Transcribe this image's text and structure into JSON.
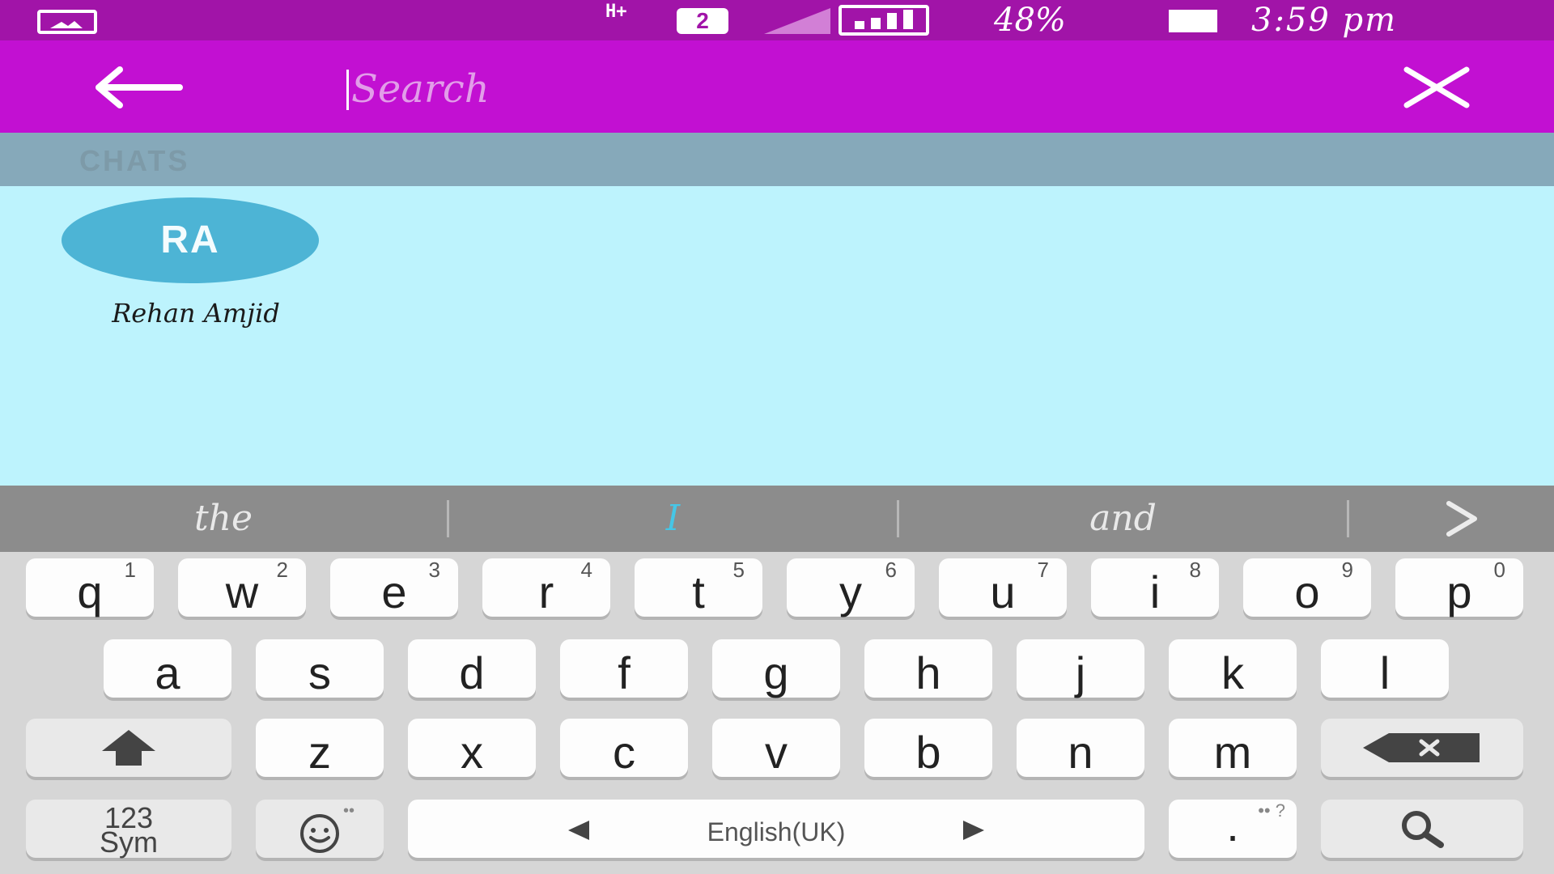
{
  "status_bar": {
    "network_label": "H+",
    "sim_label": "2",
    "battery_percent": "48%",
    "time": "3:59 pm",
    "icons": [
      "gallery-icon",
      "network-type-icon",
      "sim-icon",
      "signal-icon",
      "signal-icon",
      "battery-icon"
    ]
  },
  "toolbar": {
    "search_placeholder": "Search",
    "back_icon": "arrow-left-icon",
    "close_icon": "close-icon"
  },
  "chats": {
    "section_label": "CHATS",
    "contacts": [
      {
        "initials": "RA",
        "name": "Rehan Amjid",
        "avatar_color": "#4db4d5"
      }
    ]
  },
  "suggestions": {
    "items": [
      "the",
      "I",
      "and"
    ],
    "highlight_color": "#46c6e6",
    "more_icon": "chevron-right-icon"
  },
  "keyboard": {
    "row1": [
      {
        "key": "q",
        "num": "1"
      },
      {
        "key": "w",
        "num": "2"
      },
      {
        "key": "e",
        "num": "3"
      },
      {
        "key": "r",
        "num": "4"
      },
      {
        "key": "t",
        "num": "5"
      },
      {
        "key": "y",
        "num": "6"
      },
      {
        "key": "u",
        "num": "7"
      },
      {
        "key": "i",
        "num": "8"
      },
      {
        "key": "o",
        "num": "9"
      },
      {
        "key": "p",
        "num": "0"
      }
    ],
    "row2": [
      "a",
      "s",
      "d",
      "f",
      "g",
      "h",
      "j",
      "k",
      "l"
    ],
    "row3": [
      "z",
      "x",
      "c",
      "v",
      "b",
      "n",
      "m"
    ],
    "sym_line1": "123",
    "sym_line2": "Sym",
    "space_label": "English(UK)",
    "period_label": ".",
    "period_hint": "•• ?",
    "emoji_hint": "••",
    "shift_icon": "shift-icon",
    "backspace_icon": "backspace-icon",
    "emoji_icon": "emoji-icon",
    "search_icon": "search-icon",
    "colors": {
      "toolbar": "#c210d2",
      "status_bar": "#a114a8",
      "section_header": "#86a9ba",
      "chat_bg": "#bdf3fd"
    }
  }
}
